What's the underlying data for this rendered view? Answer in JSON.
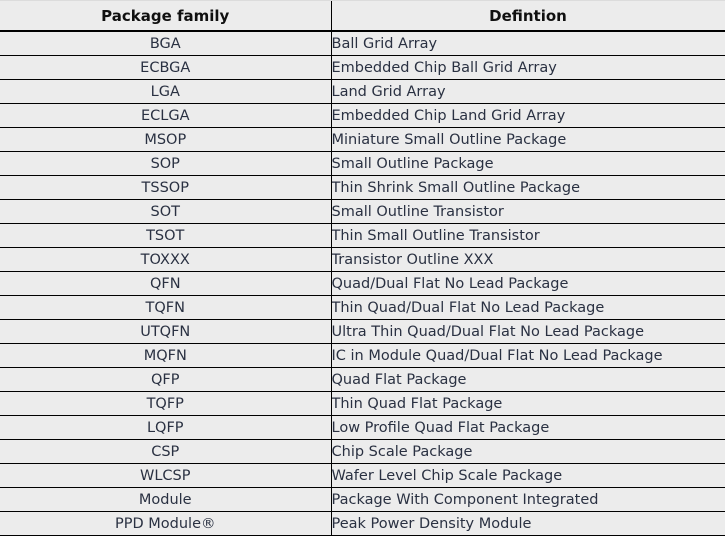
{
  "table": {
    "columns": [
      {
        "key": "family",
        "label": "Package family",
        "align": "center"
      },
      {
        "key": "definition",
        "label": "Defintion",
        "align": "left"
      }
    ],
    "colors": {
      "background": "#ececec",
      "header_text": "#101010",
      "body_text": "#2a3142",
      "rule": "#000000",
      "edge_rule": "#4a4a4a"
    },
    "rows": [
      {
        "family": "BGA",
        "definition": "Ball Grid Array"
      },
      {
        "family": "ECBGA",
        "definition": "Embedded Chip Ball Grid Array"
      },
      {
        "family": "LGA",
        "definition": "Land Grid Array"
      },
      {
        "family": "ECLGA",
        "definition": "Embedded Chip Land Grid Array"
      },
      {
        "family": "MSOP",
        "definition": "Miniature Small Outline Package"
      },
      {
        "family": "SOP",
        "definition": "Small Outline Package"
      },
      {
        "family": "TSSOP",
        "definition": "Thin Shrink Small Outline Package"
      },
      {
        "family": "SOT",
        "definition": "Small Outline Transistor"
      },
      {
        "family": "TSOT",
        "definition": "Thin Small Outline Transistor"
      },
      {
        "family": "TOXXX",
        "definition": "Transistor Outline XXX"
      },
      {
        "family": "QFN",
        "definition": "Quad/Dual Flat No Lead Package"
      },
      {
        "family": "TQFN",
        "definition": "Thin Quad/Dual Flat No Lead Package"
      },
      {
        "family": "UTQFN",
        "definition": "Ultra Thin Quad/Dual Flat No Lead Package"
      },
      {
        "family": "MQFN",
        "definition": "IC in Module Quad/Dual Flat No Lead Package"
      },
      {
        "family": "QFP",
        "definition": "Quad Flat Package"
      },
      {
        "family": "TQFP",
        "definition": "Thin Quad Flat Package"
      },
      {
        "family": "LQFP",
        "definition": "Low Profile Quad Flat Package"
      },
      {
        "family": "CSP",
        "definition": "Chip Scale Package"
      },
      {
        "family": "WLCSP",
        "definition": "Wafer Level Chip Scale Package"
      },
      {
        "family": "Module",
        "definition": "Package With Component Integrated"
      },
      {
        "family": "PPD Module®",
        "definition": "Peak Power Density Module"
      }
    ]
  }
}
